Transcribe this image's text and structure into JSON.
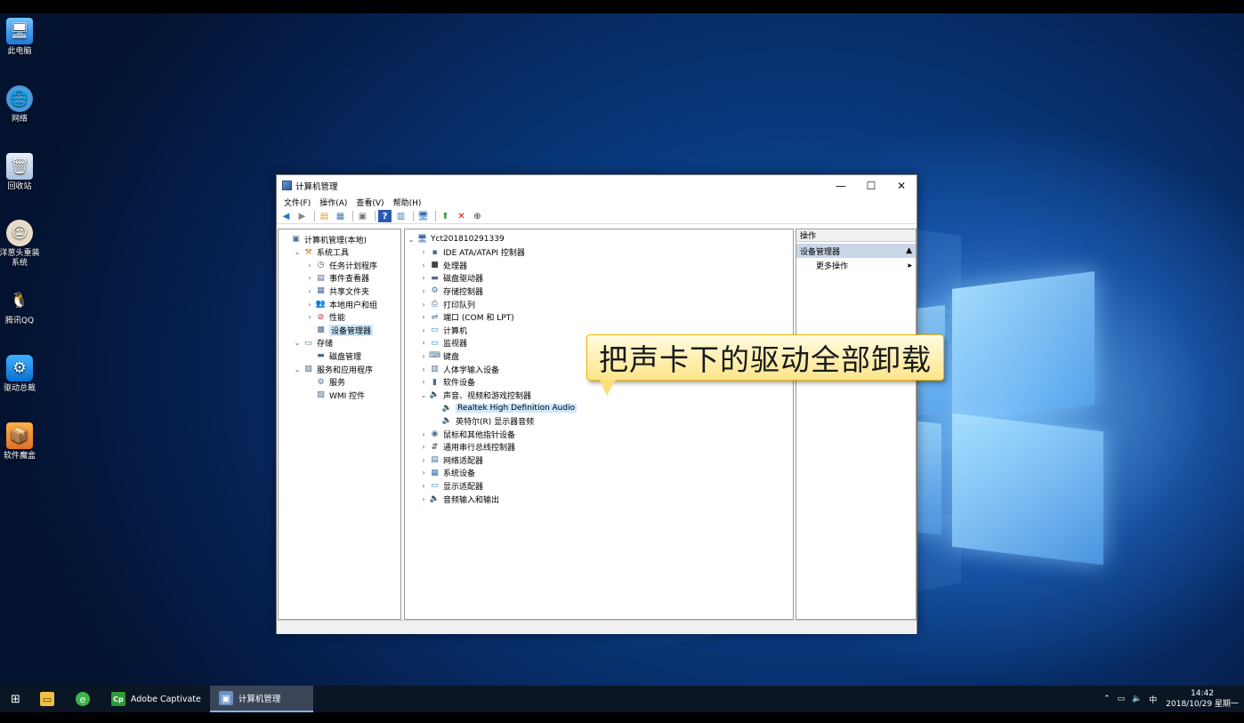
{
  "desktop": {
    "icons": [
      {
        "label": "此电脑",
        "icon": "computer-icon"
      },
      {
        "label": "网络",
        "icon": "network-icon"
      },
      {
        "label": "回收站",
        "icon": "recycle-bin-icon"
      },
      {
        "label": "洋葱头重装系统",
        "icon": "onion-app-icon"
      },
      {
        "label": "腾讯QQ",
        "icon": "qq-icon"
      },
      {
        "label": "驱动总裁",
        "icon": "driver-app-icon"
      },
      {
        "label": "软件魔盒",
        "icon": "software-box-icon"
      }
    ]
  },
  "window": {
    "title": "计算机管理",
    "menu": [
      "文件(F)",
      "操作(A)",
      "查看(V)",
      "帮助(H)"
    ],
    "left_tree": [
      {
        "label": "计算机管理(本地)",
        "icon": "computer-mgmt-icon",
        "indent": 0,
        "exp": ""
      },
      {
        "label": "系统工具",
        "icon": "tools-icon",
        "indent": 1,
        "exp": "⌄"
      },
      {
        "label": "任务计划程序",
        "icon": "clock-icon",
        "indent": 2,
        "exp": "›"
      },
      {
        "label": "事件查看器",
        "icon": "event-viewer-icon",
        "indent": 2,
        "exp": "›"
      },
      {
        "label": "共享文件夹",
        "icon": "shared-folder-icon",
        "indent": 2,
        "exp": "›"
      },
      {
        "label": "本地用户和组",
        "icon": "users-icon",
        "indent": 2,
        "exp": "›"
      },
      {
        "label": "性能",
        "icon": "performance-icon",
        "indent": 2,
        "exp": "›"
      },
      {
        "label": "设备管理器",
        "icon": "device-manager-icon",
        "indent": 2,
        "exp": "",
        "selected": true
      },
      {
        "label": "存储",
        "icon": "storage-icon",
        "indent": 1,
        "exp": "⌄"
      },
      {
        "label": "磁盘管理",
        "icon": "disk-icon",
        "indent": 2,
        "exp": ""
      },
      {
        "label": "服务和应用程序",
        "icon": "services-apps-icon",
        "indent": 1,
        "exp": "⌄"
      },
      {
        "label": "服务",
        "icon": "services-icon",
        "indent": 2,
        "exp": ""
      },
      {
        "label": "WMI 控件",
        "icon": "wmi-icon",
        "indent": 2,
        "exp": ""
      }
    ],
    "device_tree": [
      {
        "label": "Yct201810291339",
        "icon": "computer-icon",
        "indent": 0,
        "exp": "⌄"
      },
      {
        "label": "IDE ATA/ATAPI 控制器",
        "icon": "ide-icon",
        "indent": 1,
        "exp": "›"
      },
      {
        "label": "处理器",
        "icon": "cpu-icon",
        "indent": 1,
        "exp": "›"
      },
      {
        "label": "磁盘驱动器",
        "icon": "disk-drive-icon",
        "indent": 1,
        "exp": "›"
      },
      {
        "label": "存储控制器",
        "icon": "storage-controller-icon",
        "indent": 1,
        "exp": "›"
      },
      {
        "label": "打印队列",
        "icon": "printer-icon",
        "indent": 1,
        "exp": "›"
      },
      {
        "label": "端口 (COM 和 LPT)",
        "icon": "port-icon",
        "indent": 1,
        "exp": "›"
      },
      {
        "label": "计算机",
        "icon": "monitor-icon",
        "indent": 1,
        "exp": "›"
      },
      {
        "label": "监视器",
        "icon": "monitor-icon",
        "indent": 1,
        "exp": "›"
      },
      {
        "label": "键盘",
        "icon": "keyboard-icon",
        "indent": 1,
        "exp": "›"
      },
      {
        "label": "人体学输入设备",
        "icon": "hid-icon",
        "indent": 1,
        "exp": "›"
      },
      {
        "label": "软件设备",
        "icon": "software-device-icon",
        "indent": 1,
        "exp": "›"
      },
      {
        "label": "声音、视频和游戏控制器",
        "icon": "speaker-icon",
        "indent": 1,
        "exp": "⌄"
      },
      {
        "label": "Realtek High Definition Audio",
        "icon": "speaker-icon",
        "indent": 2,
        "exp": "",
        "selected": true
      },
      {
        "label": "英特尔(R) 显示器音频",
        "icon": "speaker-icon",
        "indent": 2,
        "exp": ""
      },
      {
        "label": "鼠标和其他指针设备",
        "icon": "mouse-icon",
        "indent": 1,
        "exp": "›"
      },
      {
        "label": "通用串行总线控制器",
        "icon": "usb-icon",
        "indent": 1,
        "exp": "›"
      },
      {
        "label": "网络适配器",
        "icon": "network-adapter-icon",
        "indent": 1,
        "exp": "›"
      },
      {
        "label": "系统设备",
        "icon": "system-device-icon",
        "indent": 1,
        "exp": "›"
      },
      {
        "label": "显示适配器",
        "icon": "display-adapter-icon",
        "indent": 1,
        "exp": "›"
      },
      {
        "label": "音频输入和输出",
        "icon": "audio-io-icon",
        "indent": 1,
        "exp": "›"
      }
    ],
    "actions": {
      "header": "操作",
      "section": "设备管理器",
      "more": "更多操作"
    }
  },
  "callout": {
    "text": "把声卡下的驱动全部卸载"
  },
  "taskbar": {
    "tasks": [
      {
        "label": "Adobe Captivate",
        "icon": "captivate-icon"
      },
      {
        "label": "计算机管理",
        "icon": "computer-mgmt-icon",
        "active": true
      }
    ],
    "tray": {
      "ime": "中",
      "time": "14:42",
      "date": "2018/10/29 星期一"
    }
  },
  "colors": {
    "accent": "#0078d7",
    "selection": "#cce8ff",
    "callout_border": "#f0b400"
  }
}
